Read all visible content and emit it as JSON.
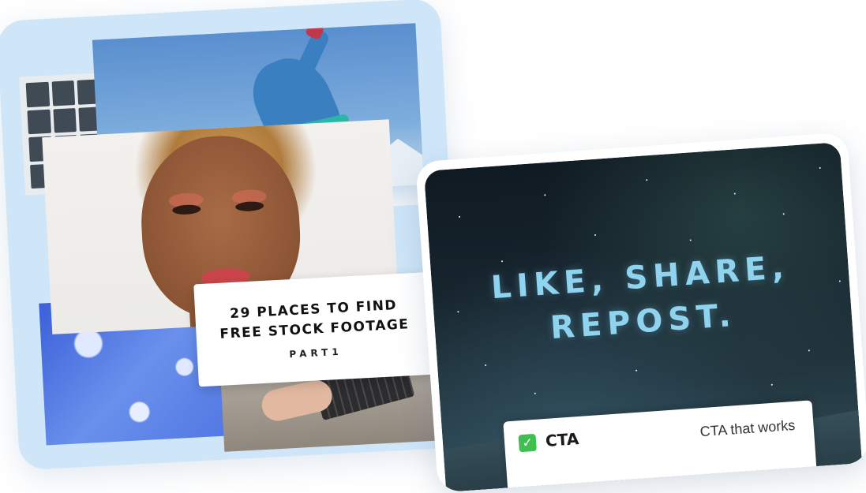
{
  "left_card": {
    "title_line1": "29 PLACES TO FIND",
    "title_line2": "FREE STOCK FOOTAGE",
    "part_label": "PART1"
  },
  "right_card": {
    "headline_line1": "LIKE, SHARE,",
    "headline_line2": "REPOST.",
    "cta_label": "CTA",
    "cta_desc": "CTA that works",
    "check_icon": "green-checkbox-icon"
  },
  "colors": {
    "left_card_bg": "#cfe6f9",
    "headline_color": "#8fd3ee",
    "check_green": "#3fbf4f",
    "night_sky": "#17252e"
  }
}
